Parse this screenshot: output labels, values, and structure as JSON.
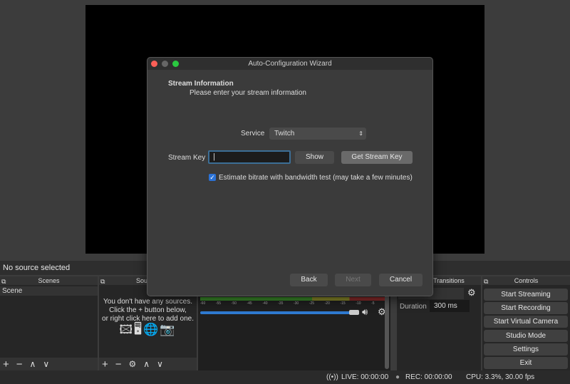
{
  "preview": {},
  "source_bar": {
    "label": "No source selected"
  },
  "scenes": {
    "title": "Scenes",
    "items": [
      "Scene"
    ]
  },
  "sources": {
    "title": "Sources",
    "empty_line1": "You don't have any sources.",
    "empty_line2": "Click the + button below,",
    "empty_line3": "or right click here to add one."
  },
  "mixer": {
    "ticks": [
      "-60",
      "-55",
      "-50",
      "-45",
      "-40",
      "-35",
      "-30",
      "-25",
      "-20",
      "-15",
      "-10",
      "-5",
      "0"
    ],
    "volume_percent": 100
  },
  "transitions": {
    "title": "Scene Transitions",
    "duration_label": "Duration",
    "duration_value": "300 ms"
  },
  "controls": {
    "title": "Controls",
    "buttons": [
      "Start Streaming",
      "Start Recording",
      "Start Virtual Camera",
      "Studio Mode",
      "Settings",
      "Exit"
    ]
  },
  "status": {
    "live": "LIVE: 00:00:00",
    "rec": "REC: 00:00:00",
    "cpu": "CPU: 3.3%, 30.00 fps"
  },
  "dialog": {
    "title": "Auto-Configuration Wizard",
    "heading": "Stream Information",
    "subheading": "Please enter your stream information",
    "service_label": "Service",
    "service_value": "Twitch",
    "stream_key_label": "Stream Key",
    "stream_key_value": "",
    "show_label": "Show",
    "get_key_label": "Get Stream Key",
    "checkbox_label": "Estimate bitrate with bandwidth test (may take a few minutes)",
    "checkbox_checked": true,
    "back_label": "Back",
    "next_label": "Next",
    "cancel_label": "Cancel"
  }
}
